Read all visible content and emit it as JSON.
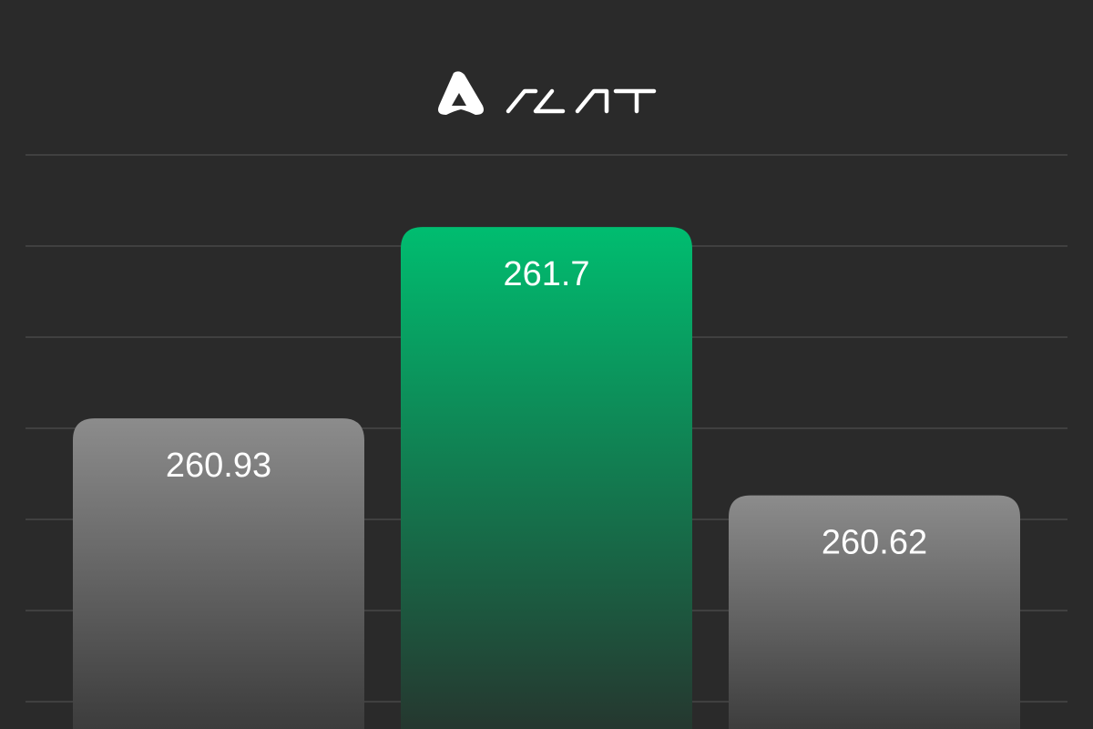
{
  "brand": {
    "name": "ALAT",
    "logo_icon": "alat-triangle-icon"
  },
  "colors": {
    "background": "#2a2a2a",
    "gridline": "#474747",
    "highlight_top": "#00bd70",
    "highlight_bottom": "#26352e",
    "neutral_top": "#8c8c8c",
    "neutral_bottom": "#3a3a3a",
    "label": "#ffffff"
  },
  "chart_data": {
    "type": "bar",
    "title": "",
    "xlabel": "",
    "ylabel": "",
    "categories": [
      "",
      "",
      ""
    ],
    "values": [
      260.93,
      261.7,
      260.62
    ],
    "labels": [
      "260.93",
      "261.7",
      "260.62"
    ],
    "highlighted_index": 1,
    "ylim": [
      259.68,
      261.99
    ],
    "grid": true,
    "legend": "none"
  }
}
